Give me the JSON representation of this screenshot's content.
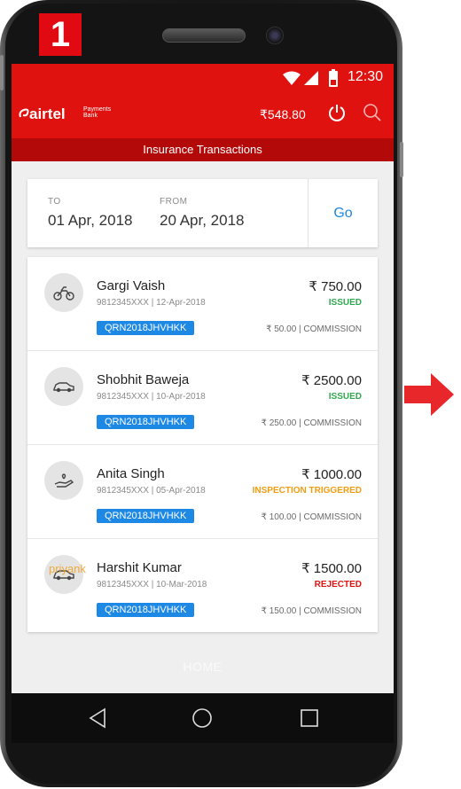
{
  "step_badge": "1",
  "statusbar": {
    "time": "12:30"
  },
  "appbar": {
    "logo_text": "airtel",
    "logo_subtext": "Payments Bank",
    "balance": "₹548.80"
  },
  "subheader": {
    "title": "Insurance Transactions"
  },
  "date_filter": {
    "to_label": "TO",
    "to_value": "01 Apr, 2018",
    "from_label": "FROM",
    "from_value": "20 Apr, 2018",
    "go_label": "Go"
  },
  "transactions": [
    {
      "icon": "motorbike-icon",
      "name": "Gargi Vaish",
      "meta": "9812345XXX | 12-Apr-2018",
      "ref": "QRN2018JHVHKK",
      "amount": "₹ 750.00",
      "status": "ISSUED",
      "status_color": "#2fa84f",
      "commission": "₹ 50.00 | COMMISSION"
    },
    {
      "icon": "car-icon",
      "name": "Shobhit Baweja",
      "meta": "9812345XXX | 10-Apr-2018",
      "ref": "QRN2018JHVHKK",
      "amount": "₹ 2500.00",
      "status": "ISSUED",
      "status_color": "#2fa84f",
      "commission": "₹ 250.00 | COMMISSION"
    },
    {
      "icon": "health-hand-icon",
      "name": "Anita Singh",
      "meta": "9812345XXX | 05-Apr-2018",
      "ref": "QRN2018JHVHKK",
      "amount": "₹ 1000.00",
      "status": "INSPECTION TRIGGERED",
      "status_color": "#f39c12",
      "commission": "₹ 100.00 | COMMISSION"
    },
    {
      "icon": "car-icon",
      "name": "Harshit Kumar",
      "meta": "9812345XXX | 10-Mar-2018",
      "ref": "QRN2018JHVHKK",
      "amount": "₹ 1500.00",
      "status": "REJECTED",
      "status_color": "#e0120f",
      "commission": "₹ 150.00 | COMMISSION",
      "watermark": "priyank"
    }
  ],
  "home_label": "HOME",
  "colors": {
    "brand_red": "#e0120f",
    "brand_dark_red": "#b30a09",
    "link_blue": "#1e88e5"
  }
}
